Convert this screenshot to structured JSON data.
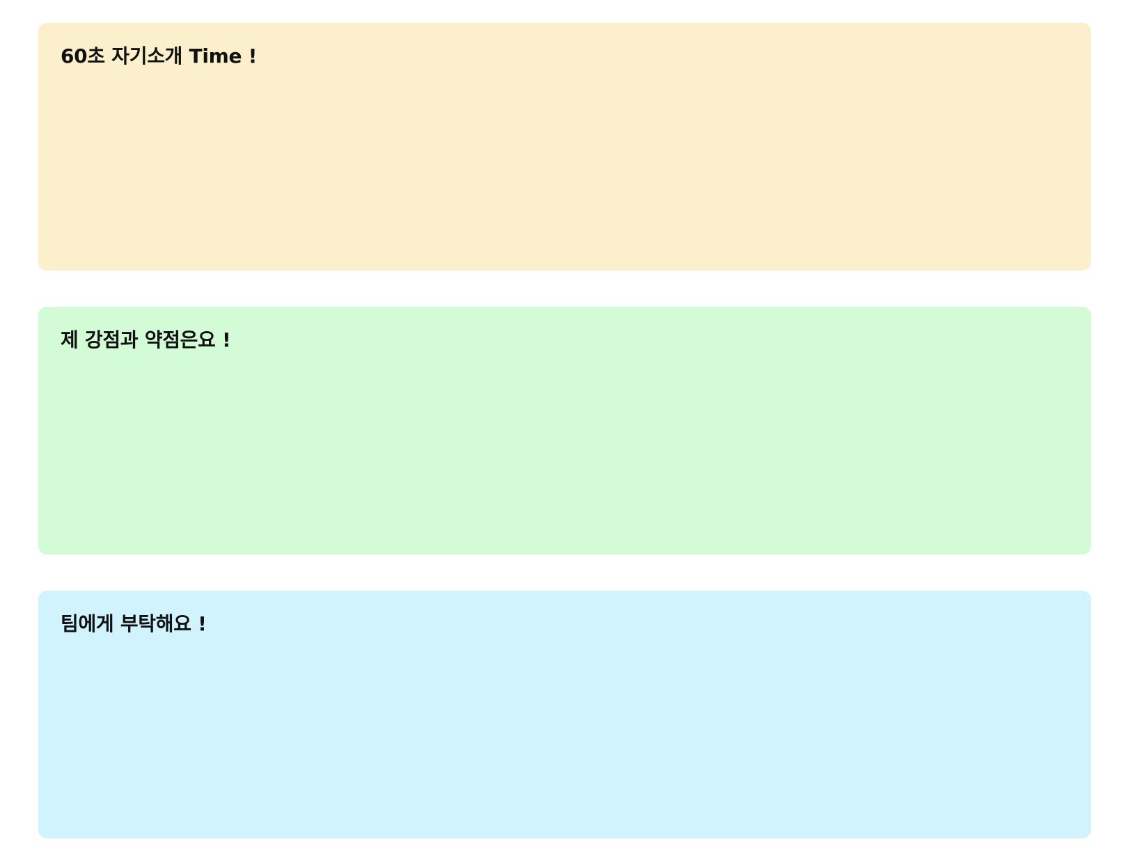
{
  "sections": [
    {
      "title": "60초 자기소개 Time !",
      "background": "#FCF0CC"
    },
    {
      "title": "제 강점과 약점은요 !",
      "background": "#D3FBD6"
    },
    {
      "title": "팀에게 부탁해요 !",
      "background": "#D1F3FD"
    }
  ]
}
